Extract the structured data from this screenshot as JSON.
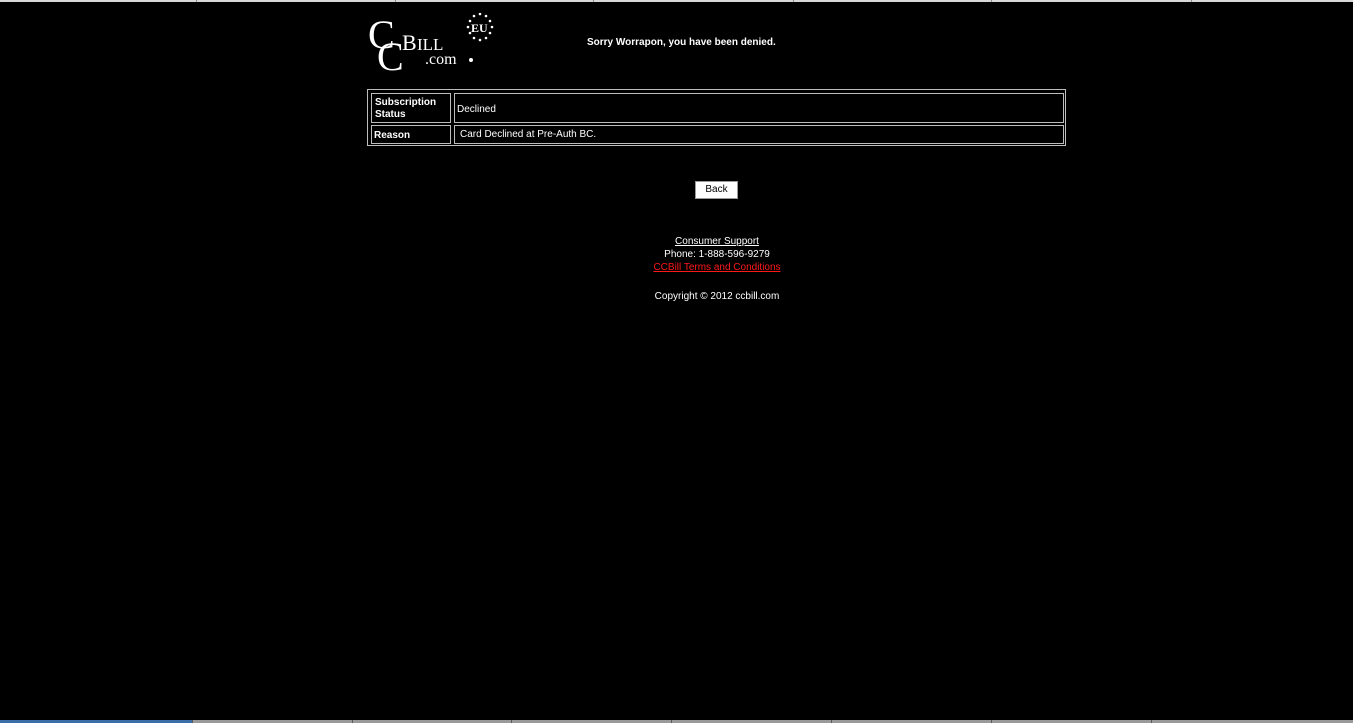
{
  "header": {
    "logo_text": "CCBILL.com EU",
    "denied_message": "Sorry Worrapon, you have been denied."
  },
  "status_table": {
    "rows": [
      {
        "label": "Subscription Status",
        "value": "Declined"
      },
      {
        "label": "Reason",
        "value": "Card Declined at Pre-Auth BC."
      }
    ]
  },
  "actions": {
    "back_label": "Back"
  },
  "footer": {
    "support_link": "Consumer Support",
    "phone": "Phone: 1-888-596-9279",
    "terms_link": "CCBill Terms and Conditions",
    "copyright": "Copyright © 2012 ccbill.com"
  },
  "colors": {
    "background": "#000000",
    "text": "#ffffff",
    "terms_link": "#ff1a1a",
    "table_border": "#bdbdbd"
  }
}
